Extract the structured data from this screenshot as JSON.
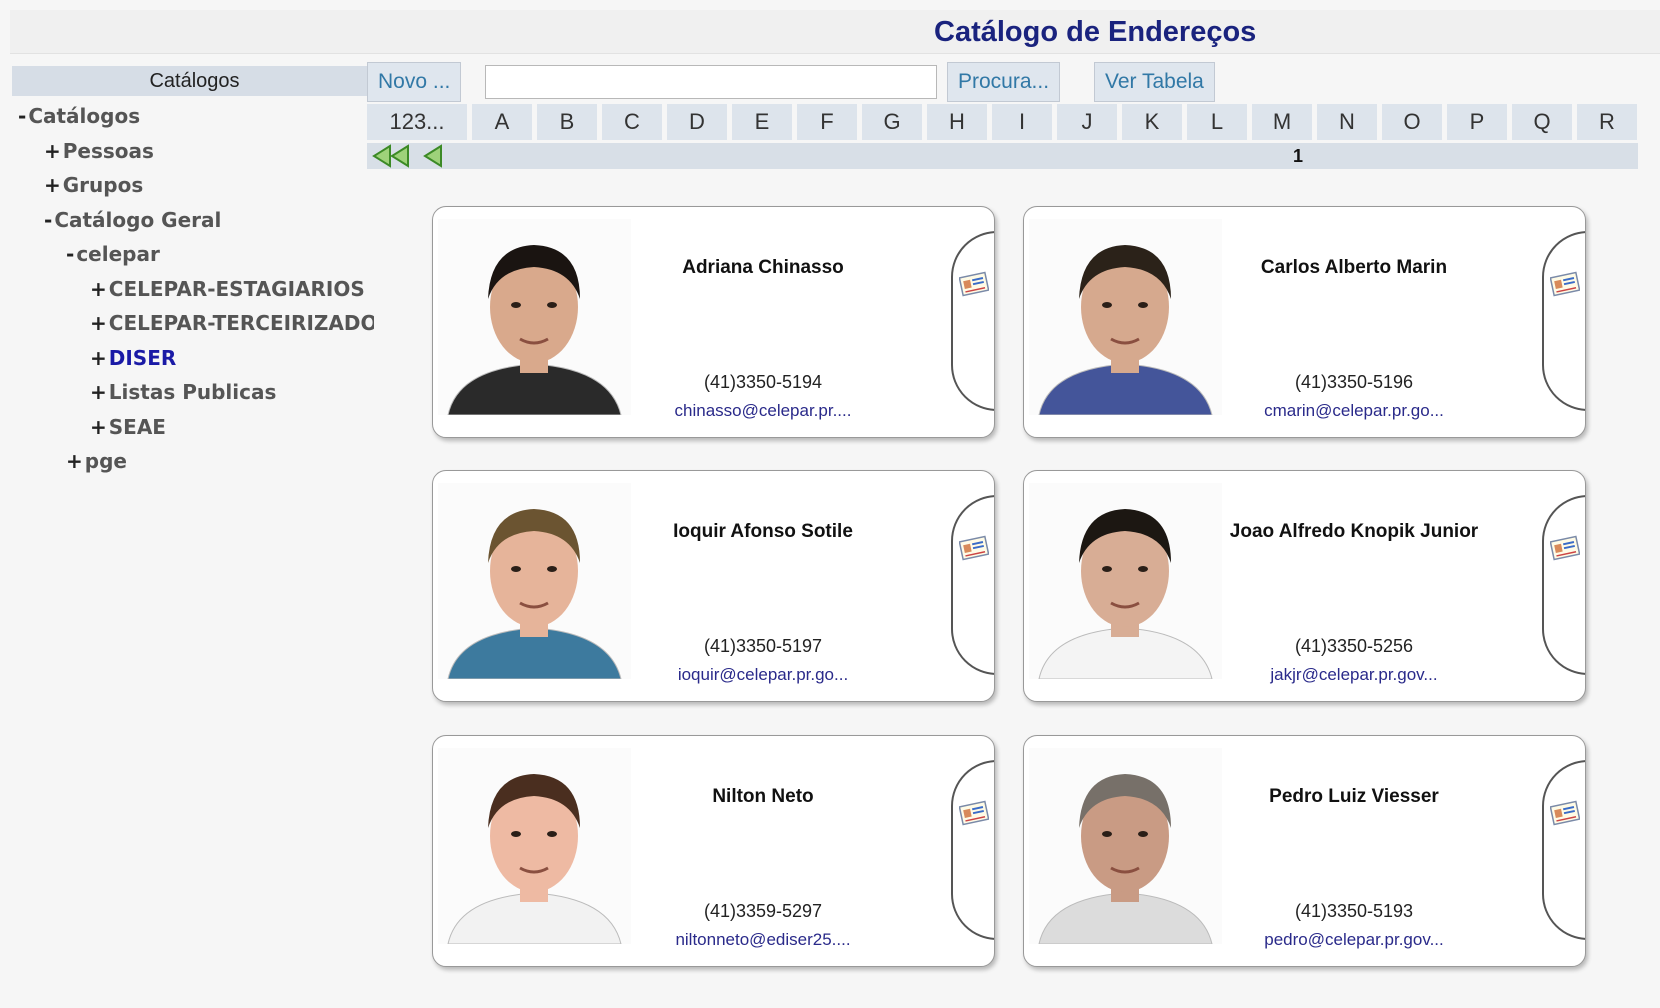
{
  "page_title": "Catálogo de Endereços",
  "sidebar": {
    "header": "Catálogos",
    "tree": [
      {
        "toggle": "-",
        "label": "Catálogos",
        "level": 0
      },
      {
        "toggle": "+",
        "label": "Pessoas",
        "level": 1
      },
      {
        "toggle": "+",
        "label": "Grupos",
        "level": 1
      },
      {
        "toggle": "-",
        "label": "Catálogo Geral",
        "level": 1
      },
      {
        "toggle": "-",
        "label": "celepar",
        "level": 2
      },
      {
        "toggle": "+",
        "label": "CELEPAR-ESTAGIARIOS",
        "level": 3
      },
      {
        "toggle": "+",
        "label": "CELEPAR-TERCEIRIZADOS",
        "level": 3
      },
      {
        "toggle": "+",
        "label": "DISER",
        "level": 3,
        "active": true
      },
      {
        "toggle": "+",
        "label": "Listas Publicas",
        "level": 3
      },
      {
        "toggle": "+",
        "label": "SEAE",
        "level": 3
      },
      {
        "toggle": "+",
        "label": "pge",
        "level": 2
      }
    ]
  },
  "toolbar": {
    "new_label": "Novo ...",
    "search_value": "",
    "search_label": "Procura...",
    "table_label": "Ver Tabela"
  },
  "letters": [
    "123...",
    "A",
    "B",
    "C",
    "D",
    "E",
    "F",
    "G",
    "H",
    "I",
    "J",
    "K",
    "L",
    "M",
    "N",
    "O",
    "P",
    "Q",
    "R"
  ],
  "pager": {
    "current_page": "1"
  },
  "contacts": [
    {
      "name": "Adriana Chinasso",
      "phone": "(41)3350-5194",
      "email": "chinasso@celepar.pr....",
      "skin": "#d9a98c",
      "hair": "#1a1411",
      "shirt": "#2a2a2a"
    },
    {
      "name": "Carlos Alberto Marin",
      "phone": "(41)3350-5196",
      "email": "cmarin@celepar.pr.go...",
      "skin": "#d6a98e",
      "hair": "#2b2219",
      "shirt": "#44559a"
    },
    {
      "name": "Ioquir Afonso Sotile",
      "phone": "(41)3350-5197",
      "email": "ioquir@celepar.pr.go...",
      "skin": "#e6b49a",
      "hair": "#6b5431",
      "shirt": "#3d7a9e"
    },
    {
      "name": "Joao Alfredo Knopik Junior",
      "phone": "(41)3350-5256",
      "email": "jakjr@celepar.pr.gov...",
      "skin": "#d8ad95",
      "hair": "#1c1712",
      "shirt": "#f4f4f4"
    },
    {
      "name": "Nilton Neto",
      "phone": "(41)3359-5297",
      "email": "niltonneto@ediser25....",
      "skin": "#eebaa3",
      "hair": "#4a2e1f",
      "shirt": "#f2f2f2"
    },
    {
      "name": "Pedro Luiz Viesser",
      "phone": "(41)3350-5193",
      "email": "pedro@celepar.pr.gov...",
      "skin": "#c99b84",
      "hair": "#777069",
      "shirt": "#dcdcdc"
    }
  ]
}
